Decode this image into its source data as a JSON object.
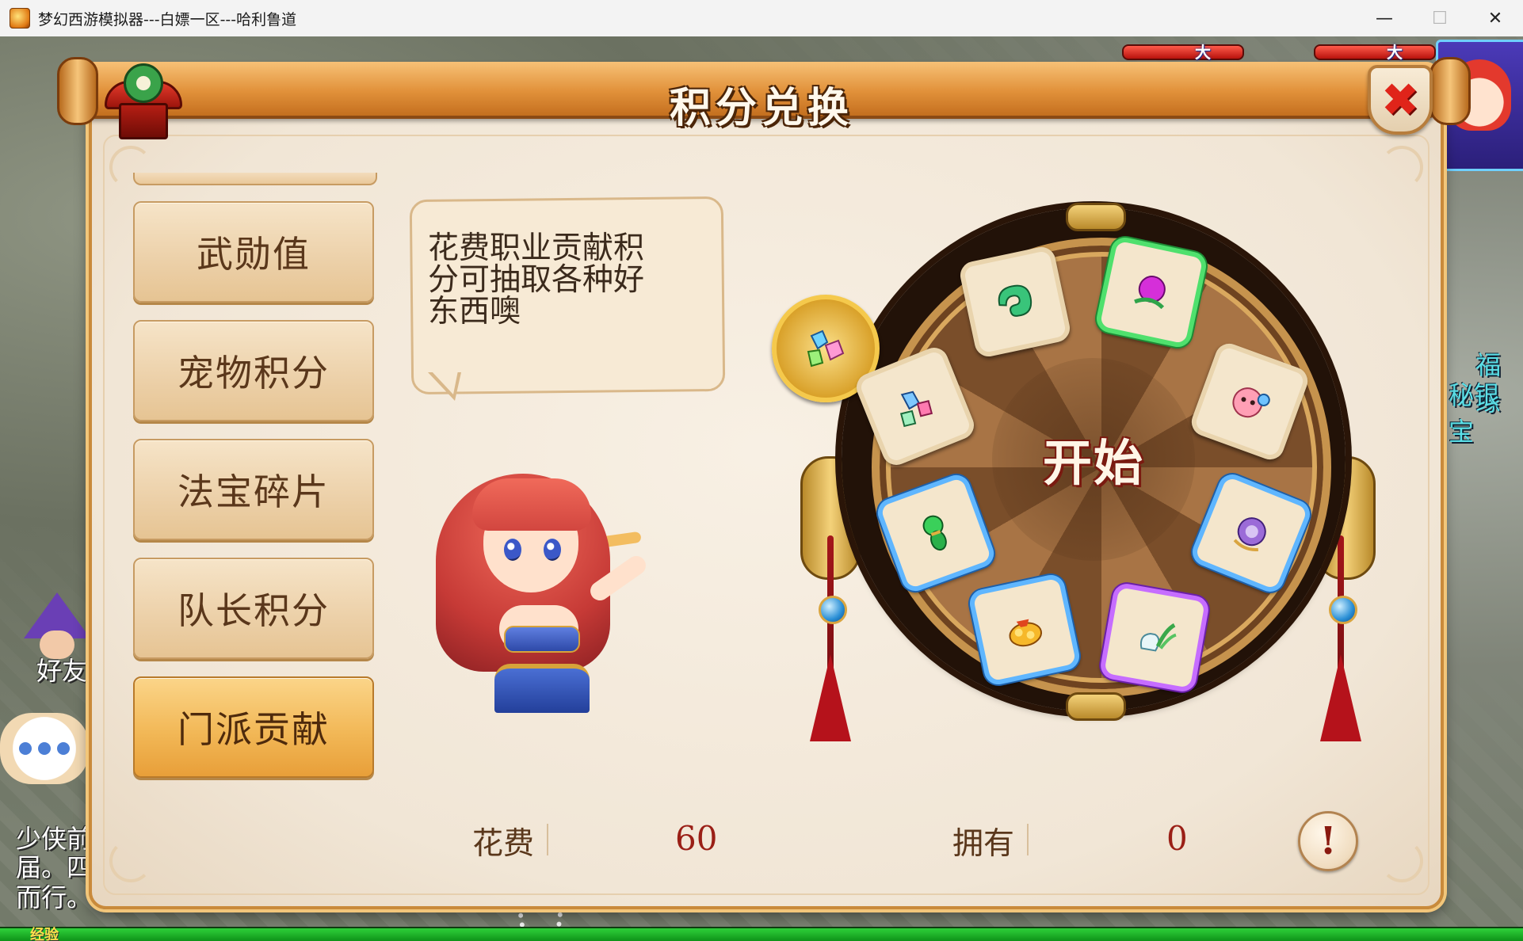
{
  "window": {
    "title": "梦幻西游模拟器---白嫖一区---哈利鲁道",
    "minimize_glyph": "—",
    "maximize_glyph": "☐",
    "close_glyph": "✕"
  },
  "background": {
    "hp_tags": [
      "大神",
      "大神"
    ],
    "left_labels": {
      "friend": "好友",
      "line1": "少侠前",
      "line2": "届。四",
      "line3": "而行。"
    },
    "right_labels": {
      "line1": "福缘",
      "line2": "秘银宝"
    },
    "exp_label": "经验"
  },
  "dialog": {
    "title": "积分兑换",
    "close_icon": "close-icon",
    "categories": [
      {
        "label": "武勋值",
        "active": false
      },
      {
        "label": "宠物积分",
        "active": false
      },
      {
        "label": "法宝碎片",
        "active": false
      },
      {
        "label": "队长积分",
        "active": false
      },
      {
        "label": "门派贡献",
        "active": true
      }
    ],
    "bubble_text": "花费职业贡献积分可抽取各种好东西噢",
    "wheel": {
      "start_label": "开始",
      "items": [
        {
          "icon": "gem-cluster-icon",
          "rarity": "gold"
        },
        {
          "icon": "jade-ring-icon",
          "rarity": "normal"
        },
        {
          "icon": "purple-orb-icon",
          "rarity": "green"
        },
        {
          "icon": "pet-egg-icon",
          "rarity": "normal"
        },
        {
          "icon": "crystal-bundle-icon",
          "rarity": "normal"
        },
        {
          "icon": "green-gourd-icon",
          "rarity": "blue"
        },
        {
          "icon": "purple-shell-icon",
          "rarity": "blue"
        },
        {
          "icon": "gold-treasure-icon",
          "rarity": "blue"
        },
        {
          "icon": "vase-herb-icon",
          "rarity": "purple"
        }
      ]
    },
    "footer": {
      "cost_label": "花费",
      "cost_value": "60",
      "own_label": "拥有",
      "own_value": "0",
      "info_glyph": "!"
    }
  },
  "colors": {
    "accent": "#e89f39",
    "title_text": "#fff8ec",
    "value_red": "#9a1f16",
    "close_red": "#e0241a"
  }
}
